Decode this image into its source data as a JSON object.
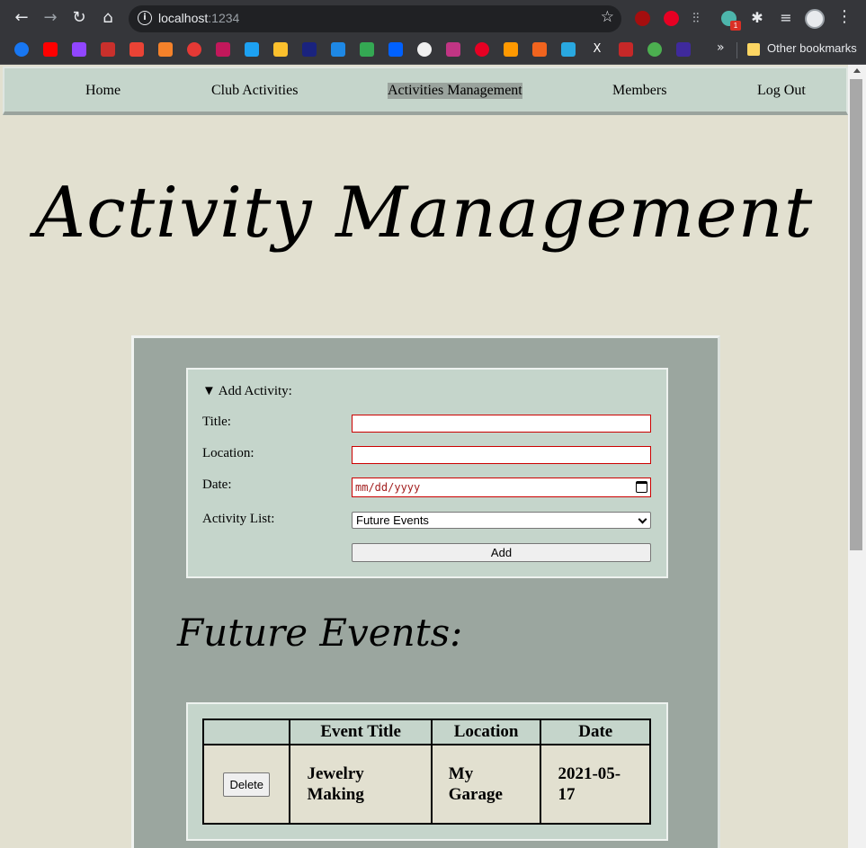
{
  "browser": {
    "url_host": "localhost",
    "url_port": ":1234",
    "other_bookmarks": "Other bookmarks",
    "extension_badge": "1"
  },
  "nav": {
    "home": "Home",
    "club_activities": "Club Activities",
    "activities_management": "Activities Management",
    "members": "Members",
    "log_out": "Log Out"
  },
  "page_title": "Activity Management",
  "form": {
    "summary": "▼ Add Activity:",
    "title_label": "Title:",
    "title_value": "",
    "location_label": "Location:",
    "location_value": "",
    "date_label": "Date:",
    "date_placeholder": "mm/dd/yyyy",
    "list_label": "Activity List:",
    "list_selected": "Future Events",
    "add_label": "Add"
  },
  "section_title": "Future Events:",
  "table": {
    "headers": [
      "",
      "Event Title",
      "Location",
      "Date"
    ],
    "rows": [
      {
        "action": "Delete",
        "title": "Jewelry Making",
        "location": "My Garage",
        "date": "2021-05-17"
      }
    ]
  }
}
